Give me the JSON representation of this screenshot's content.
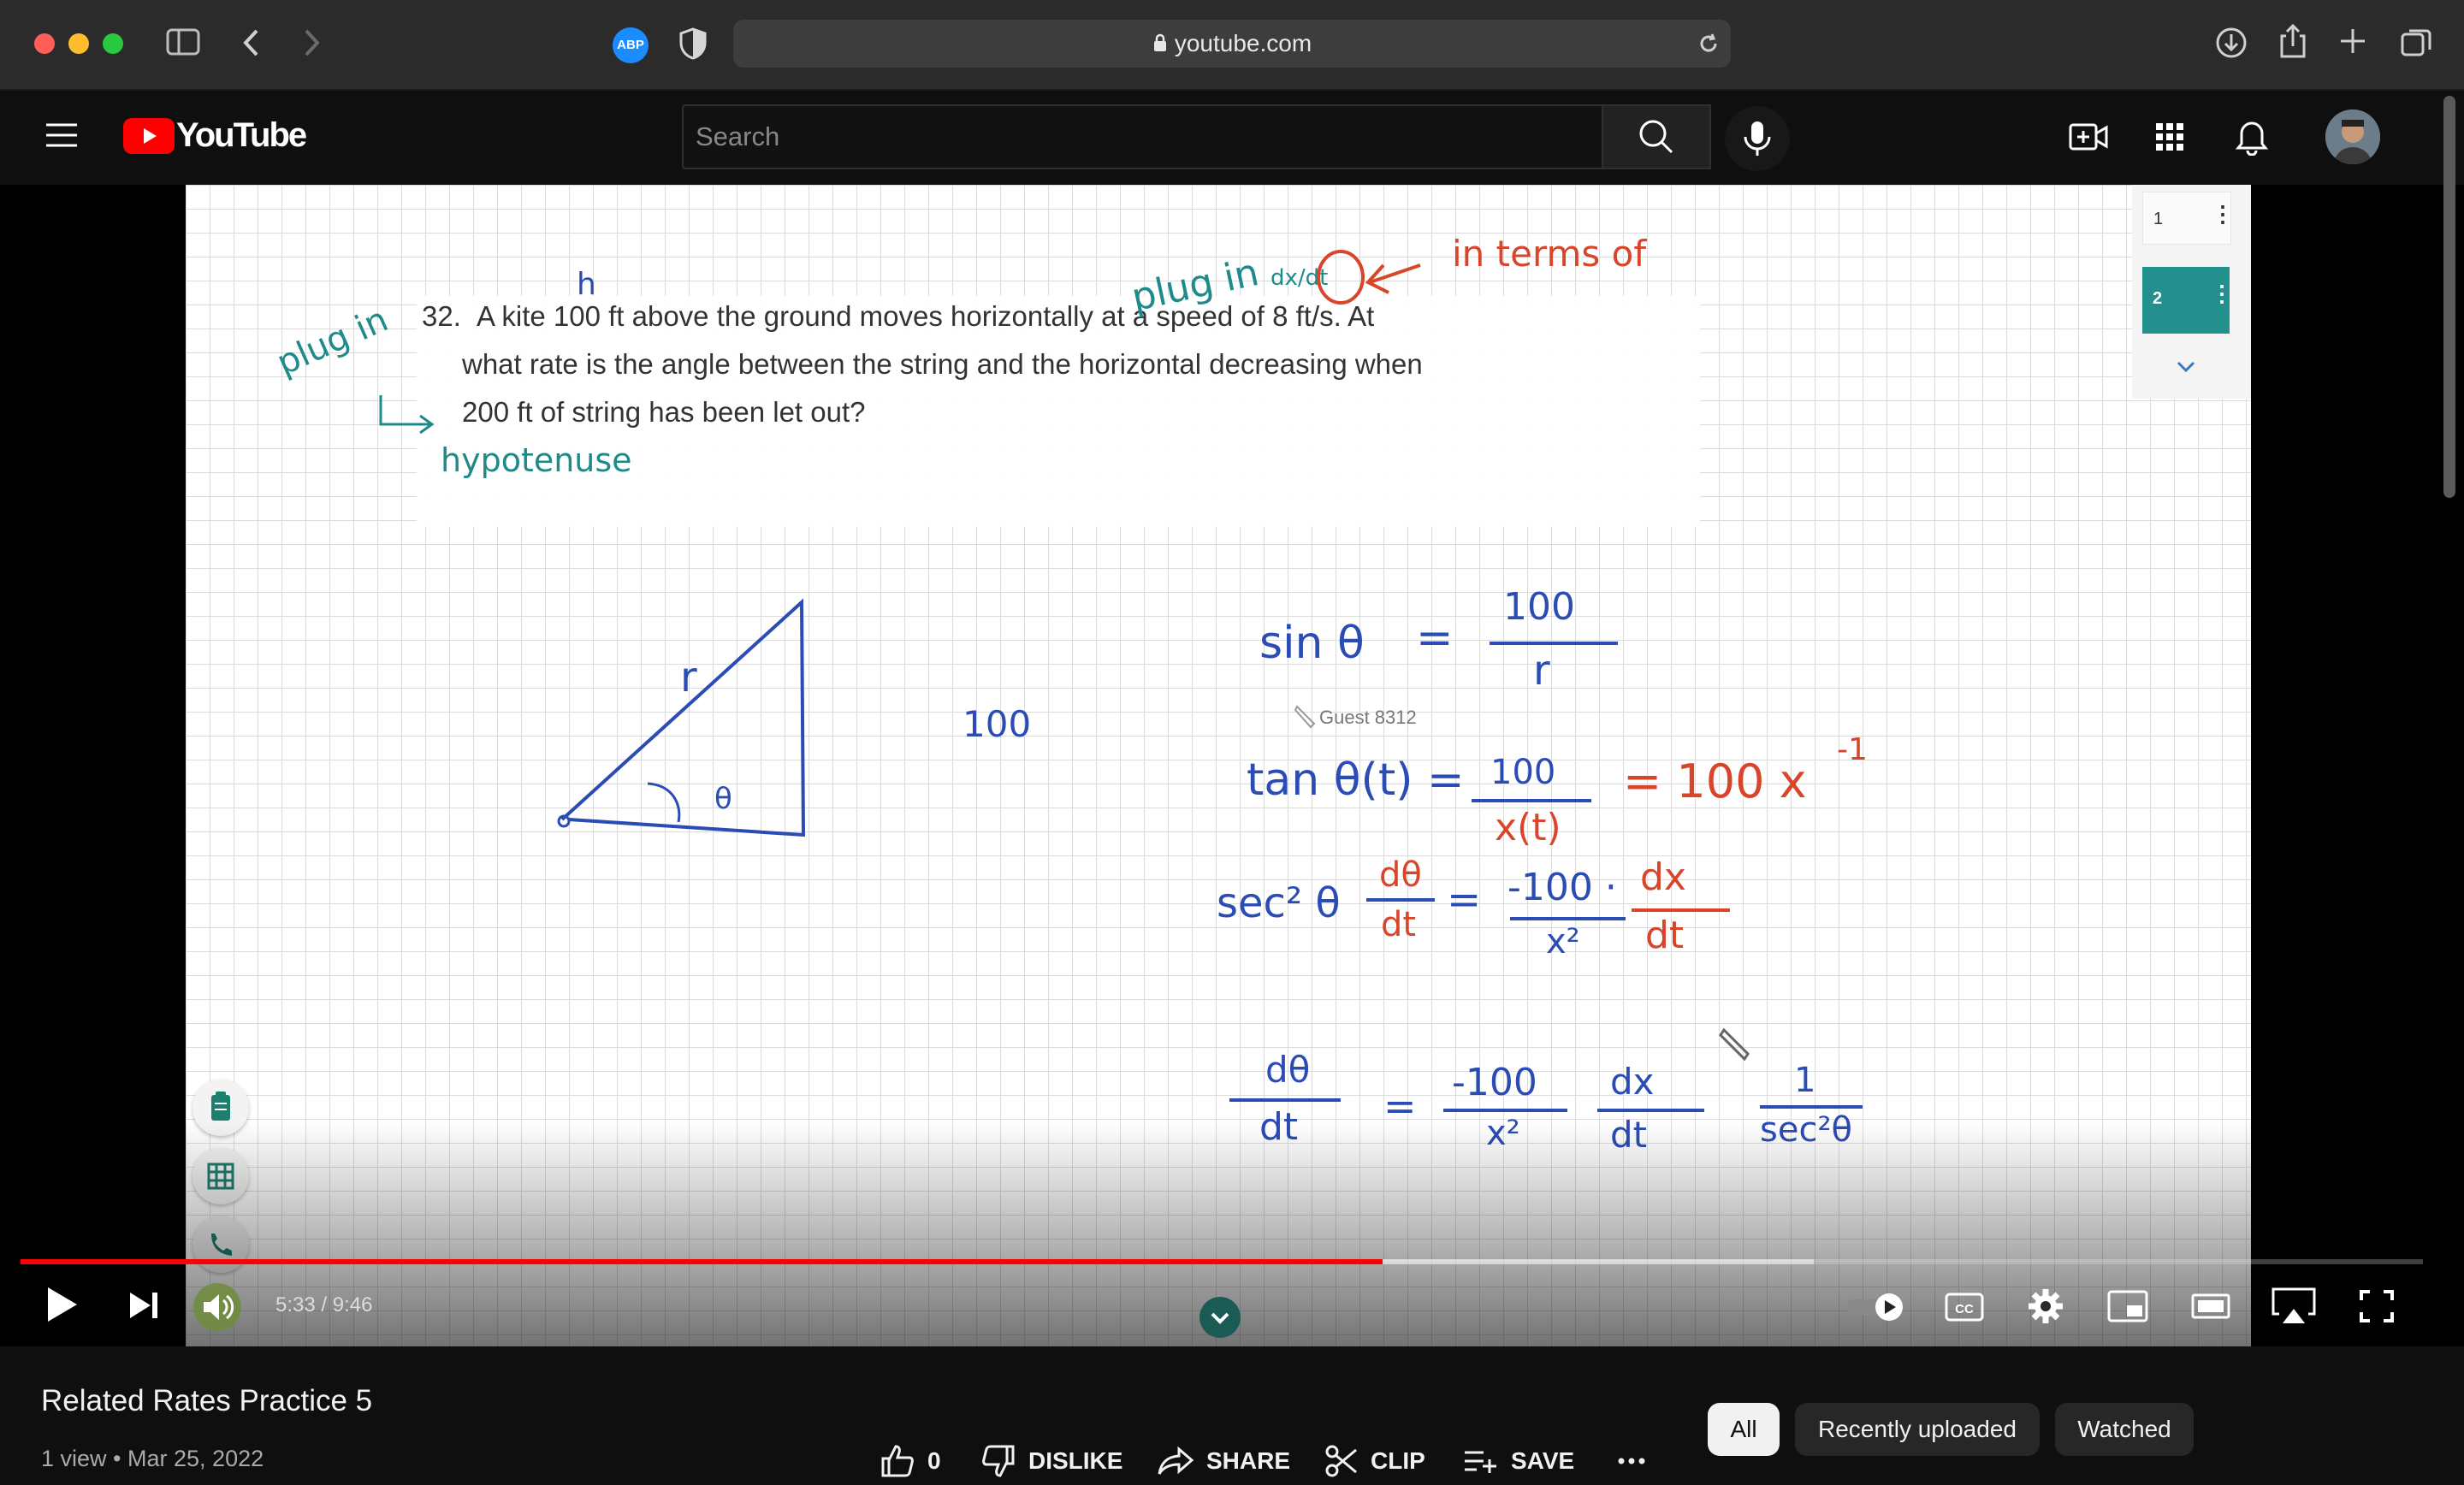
{
  "browser": {
    "url": "youtube.com",
    "extension_badge": "ABP"
  },
  "header": {
    "logo_text": "YouTube",
    "search_placeholder": "Search"
  },
  "board": {
    "problem_number": "32.",
    "problem_lines": [
      "A kite 100 ft above the ground moves horizontally at a speed of 8 ft/s. At",
      "what rate is the angle between the string and the horizontal decreasing when",
      "200 ft of string has been let out?"
    ],
    "notes": {
      "plug_in_left": "plug in",
      "hypotenuse": "hypotenuse",
      "h_mark": "h",
      "plug_in_top": "plug in",
      "dx_dt": "dx/dt",
      "in_terms_of": "in terms of",
      "r_label": "r",
      "side_100": "100",
      "theta": "θ",
      "eq1_lhs": "sin θ",
      "eq1_num": "100",
      "eq1_den": "r",
      "eq2_lhs": "tan θ(t) =",
      "eq2_num": "100",
      "eq2_den": "x(t)",
      "eq2_rhs": "= 100 x",
      "eq2_exp": "-1",
      "eq3_lhs": "sec² θ",
      "eq3_dtheta": "dθ",
      "eq3_dt": "dt",
      "eq3_coef": "-100 ·",
      "eq3_den": "x²",
      "eq3_dx": "dx",
      "eq4_num": "dθ",
      "eq4_den": "dt",
      "eq4_coef": "-100",
      "eq4_x2": "x²",
      "eq4_dx": "dx",
      "eq4_dt": "dt",
      "eq4_one": "1",
      "eq4_sec": "sec²θ"
    },
    "guest_label": "Guest 8312",
    "pages": [
      "1",
      "2"
    ]
  },
  "player": {
    "time": "5:33 / 9:46",
    "progress_fraction": 0.567
  },
  "video": {
    "title": "Related Rates Practice 5",
    "views": "1 view",
    "date": "Mar 25, 2022",
    "meta_separator": "•",
    "likes": "0",
    "dislike_label": "DISLIKE",
    "share_label": "SHARE",
    "clip_label": "CLIP",
    "save_label": "SAVE"
  },
  "chips": [
    "All",
    "Recently uploaded",
    "Watched"
  ],
  "colors": {
    "youtube_red": "#ff0000",
    "ink_blue": "#2b4bb5",
    "ink_red": "#d8452b",
    "ink_teal": "#1f8a8a",
    "accent_teal": "#23908e"
  }
}
